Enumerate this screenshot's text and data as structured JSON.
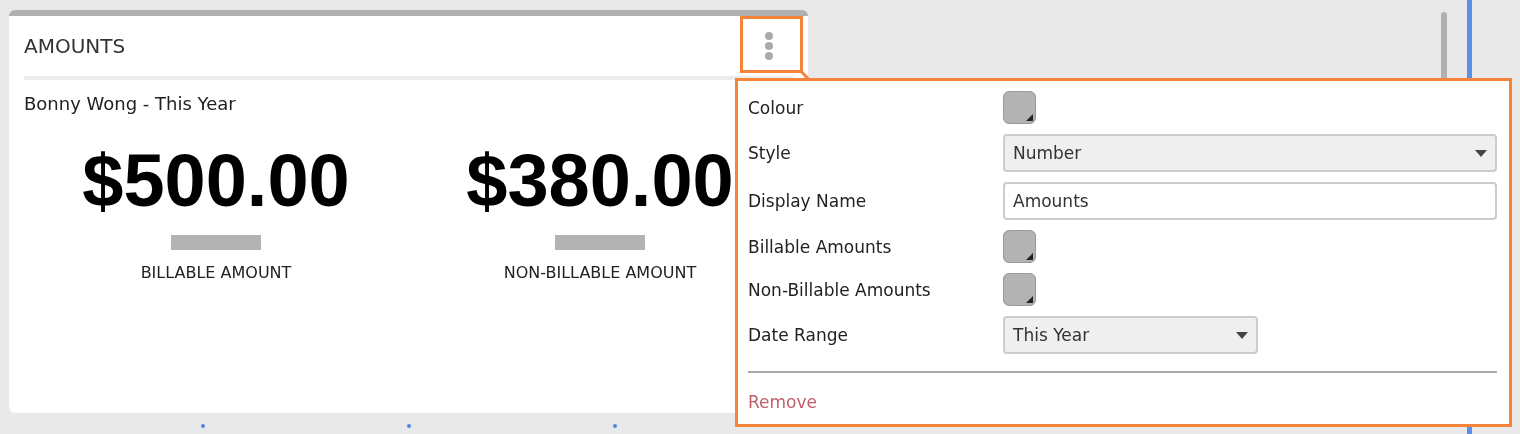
{
  "card": {
    "title": "AMOUNTS",
    "subtitle": "Bonny Wong - This Year",
    "metrics": [
      {
        "value": "$500.00",
        "label": "BILLABLE AMOUNT",
        "color": "#b3b3b3"
      },
      {
        "value": "$380.00",
        "label": "NON-BILLABLE AMOUNT",
        "color": "#b3b3b3"
      }
    ]
  },
  "settings_menu": {
    "fields": [
      {
        "kind": "swatch",
        "label": "Colour",
        "color": "#b3b3b3"
      },
      {
        "kind": "select",
        "label": "Style",
        "value": "Number"
      },
      {
        "kind": "text",
        "label": "Display Name",
        "value": "Amounts"
      },
      {
        "kind": "swatch",
        "label": "Billable Amounts",
        "color": "#b3b3b3"
      },
      {
        "kind": "swatch",
        "label": "Non-Billable Amounts",
        "color": "#b3b3b3"
      },
      {
        "kind": "select",
        "label": "Date Range",
        "value": "This Year"
      }
    ],
    "remove_link": "Remove"
  }
}
